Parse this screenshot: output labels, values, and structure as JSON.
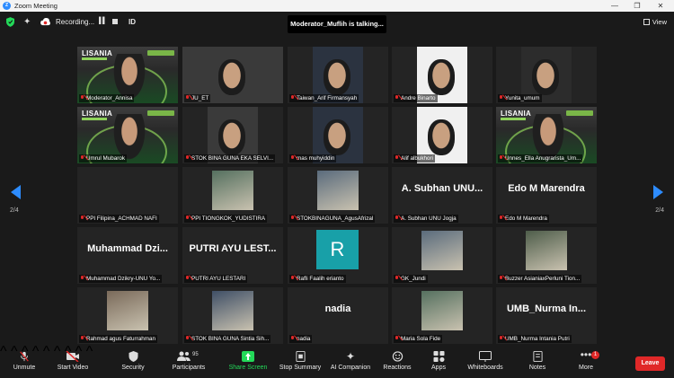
{
  "window": {
    "title": "Zoom Meeting"
  },
  "topbar": {
    "recording_text": "Recording...",
    "id_label": "ID",
    "talking_banner": "Moderator_Muflih is talking...",
    "view_label": "View"
  },
  "pagination": {
    "left": "2/4",
    "right": "2/4"
  },
  "participants": [
    {
      "name": "Moderator_Annisa",
      "type": "lisania"
    },
    {
      "name": "JU_ET",
      "type": "video"
    },
    {
      "name": "Taiwan_Arif Firmansyah",
      "type": "video"
    },
    {
      "name": "Andre Binarto",
      "type": "video"
    },
    {
      "name": "Yunita_umum",
      "type": "video"
    },
    {
      "name": "Umrul Mubarok",
      "type": "lisania"
    },
    {
      "name": "STOK BINA GUNA EKA SELVI...",
      "type": "video"
    },
    {
      "name": "mas muhyiddin",
      "type": "video"
    },
    {
      "name": "Alif albukhori",
      "type": "video"
    },
    {
      "name": "Unnes_Ella Anugrarista_Um...",
      "type": "lisania"
    },
    {
      "name": "PPI Filipina_ACHMAD NAFI",
      "type": "blank"
    },
    {
      "name": "PPI TIONGKOK_YUDISTIRA",
      "type": "photo"
    },
    {
      "name": "STOKBINAGUNA_AgusAfrizal",
      "type": "photo"
    },
    {
      "name": "A. Subhan UNU Jogja",
      "type": "text",
      "big": "A. Subhan UNU..."
    },
    {
      "name": "Edo M Marendra",
      "type": "text",
      "big": "Edo M Marendra"
    },
    {
      "name": "Muhammad Dzikry-UNU Yo...",
      "type": "text",
      "big": "Muhammad  Dzi..."
    },
    {
      "name": "PUTRI AYU LESTARI",
      "type": "text",
      "big": "PUTRI AYU LEST..."
    },
    {
      "name": "Rafli Faalih erianto",
      "type": "avatar",
      "letter": "R"
    },
    {
      "name": "GK_Jundi",
      "type": "photo"
    },
    {
      "name": "Buzzer AsianiaxPerluni Tion...",
      "type": "photo"
    },
    {
      "name": "Rahmad agus Faturrahman",
      "type": "photo"
    },
    {
      "name": "STOK  BINA GUNA Sintia Sih...",
      "type": "photo"
    },
    {
      "name": "nadia",
      "type": "text",
      "big": "nadia"
    },
    {
      "name": "Maria Sola Fide",
      "type": "photo"
    },
    {
      "name": "UMB_Nurma Intania Putri",
      "type": "text",
      "big": "UMB_Nurma  In..."
    }
  ],
  "toolbar": {
    "unmute": "Unmute",
    "start_video": "Start Video",
    "security": "Security",
    "participants": "Participants",
    "participants_count": "95",
    "share_screen": "Share Screen",
    "stop_summary": "Stop Summary",
    "ai_companion": "AI Companion",
    "reactions": "Reactions",
    "apps": "Apps",
    "whiteboards": "Whiteboards",
    "notes": "Notes",
    "more": "More",
    "more_badge": "1",
    "leave": "Leave"
  },
  "colors": {
    "accent": "#2d8cff",
    "leave": "#e02828",
    "share": "#23d959",
    "lisania_green": "#8fd35a"
  }
}
